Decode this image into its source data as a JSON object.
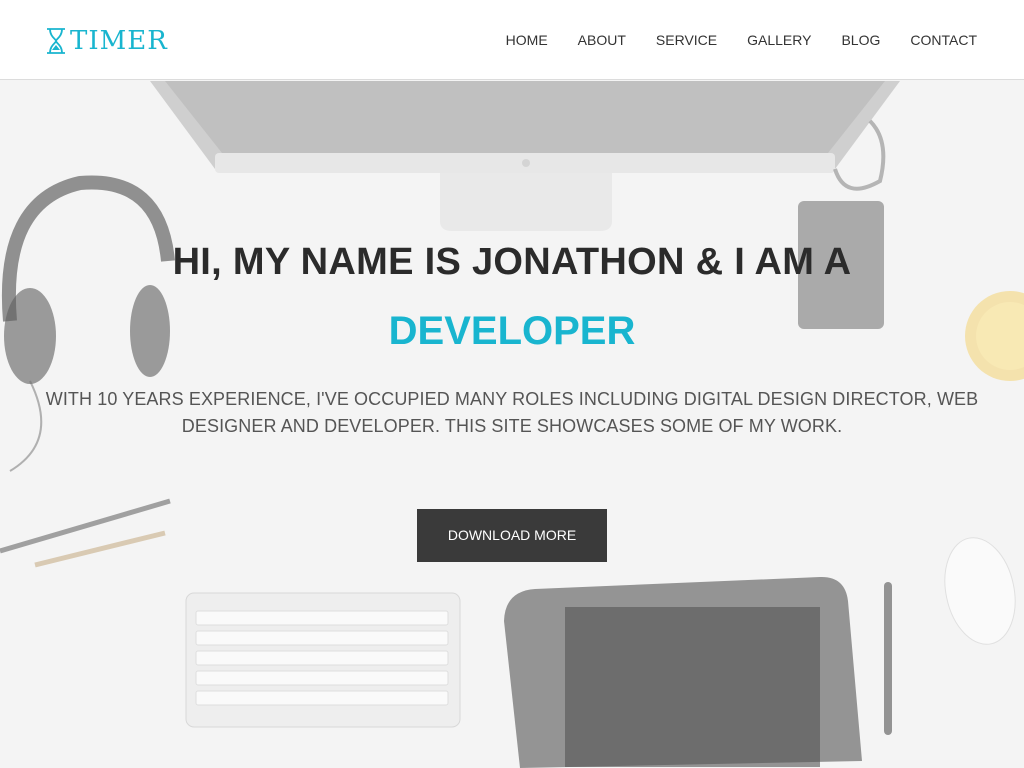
{
  "header": {
    "logo_text": "TIMER",
    "nav": [
      "HOME",
      "ABOUT",
      "SERVICE",
      "GALLERY",
      "BLOG",
      "CONTACT"
    ]
  },
  "hero": {
    "headline": "HI, MY NAME IS JONATHON & I AM A",
    "role": "DEVELOPER",
    "tagline": "WITH 10 YEARS EXPERIENCE, I'VE OCCUPIED MANY ROLES INCLUDING DIGITAL DESIGN DIRECTOR, WEB DESIGNER AND DEVELOPER. THIS SITE SHOWCASES SOME OF MY WORK.",
    "button_label": "DOWNLOAD MORE"
  },
  "colors": {
    "accent": "#19b5cf",
    "text_dark": "#2b2b2b",
    "button_bg": "#3a3a3a"
  },
  "icons": {
    "logo": "hourglass-icon"
  }
}
